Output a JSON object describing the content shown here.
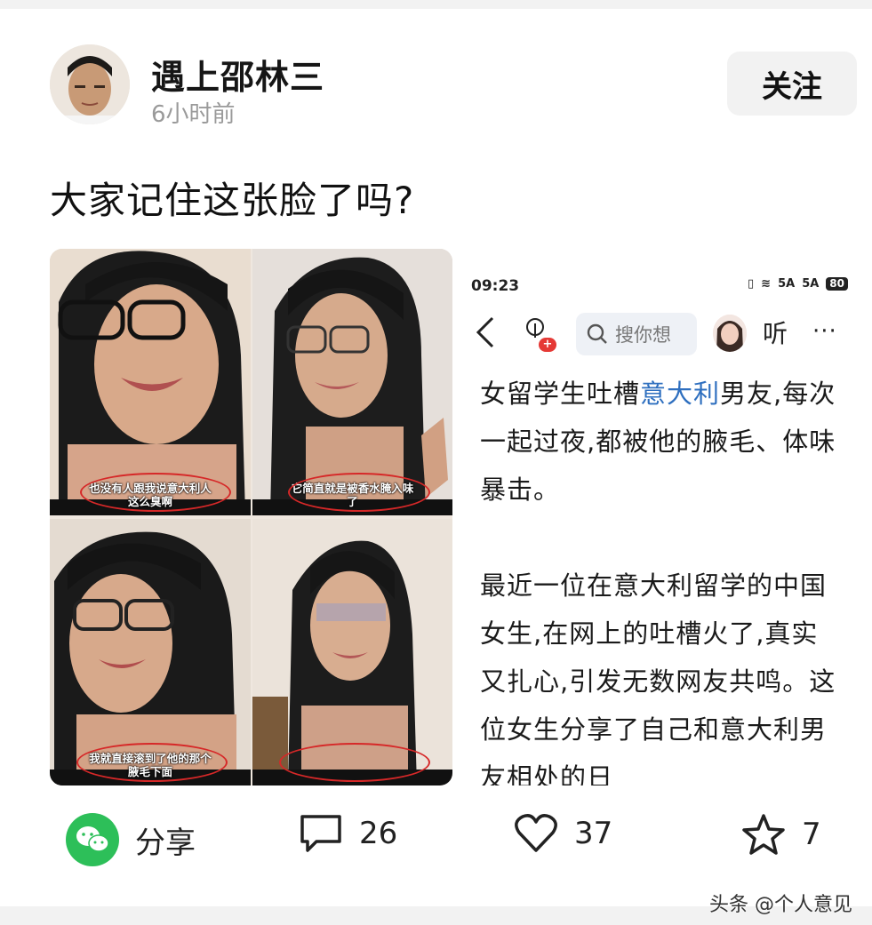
{
  "author": {
    "name": "遇上邵林三",
    "time": "6小时前",
    "follow_label": "关注"
  },
  "post": {
    "title": "大家记住这张脸了吗?"
  },
  "collage": {
    "captions": [
      [
        "也没有人跟我说意大利人",
        "这么臭啊"
      ],
      [
        "它简直就是被香水腌入味",
        "了"
      ],
      [
        "我就直接滚到了他的那个",
        "腋毛下面"
      ]
    ]
  },
  "screenshot": {
    "status_time": "09:23",
    "signal_5g_a": "5A",
    "signal_5g_b": "5A",
    "battery": "80",
    "search_placeholder": "搜你想",
    "listen_label": "听",
    "more_label": "···",
    "article": {
      "p1_before": "女留学生吐槽",
      "p1_link": "意大利",
      "p1_after": "男友,每次一起过夜,都被他的腋毛、体味暴击。",
      "p2": "最近一位在意大利留学的中国女生,在网上的吐槽火了,真实又扎心,引发无数网友共鸣。这位女生分享了自己和意大利男友相处的日"
    }
  },
  "actions": {
    "share_label": "分享",
    "comments": "26",
    "likes": "37",
    "favorites": "7"
  },
  "watermark": "头条 @个人意见",
  "colors": {
    "accent_link": "#2e6fbf",
    "wechat_green": "#2dbf59",
    "ring_red": "#d62828"
  }
}
